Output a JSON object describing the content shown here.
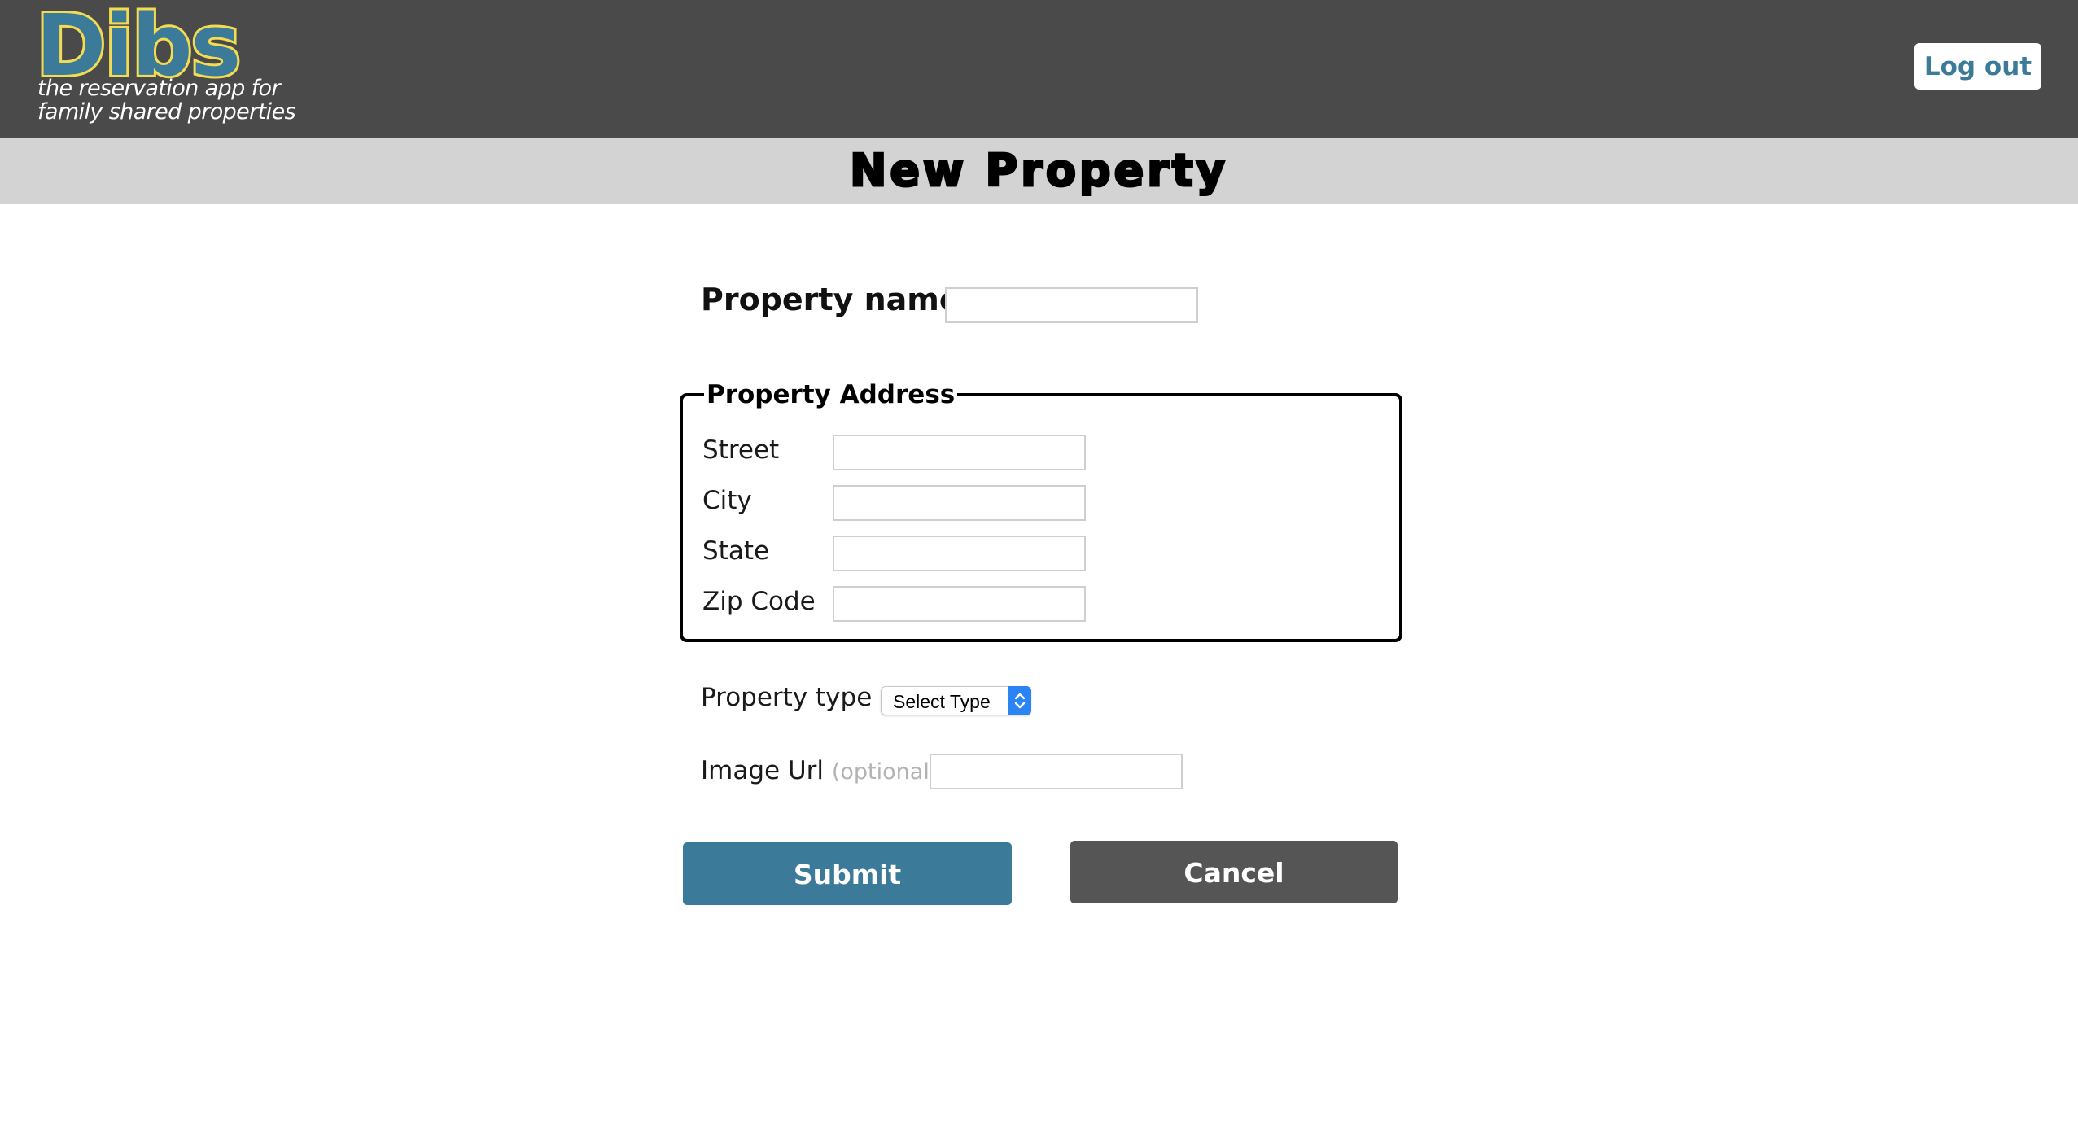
{
  "header": {
    "logo_text": "Dibs",
    "tagline_line1": "the reservation app for",
    "tagline_line2": "family shared properties",
    "logout_label": "Log out"
  },
  "page": {
    "title": "New Property"
  },
  "form": {
    "property_name": {
      "label": "Property name",
      "value": ""
    },
    "address": {
      "legend": "Property Address",
      "street_label": "Street",
      "street_value": "",
      "city_label": "City",
      "city_value": "",
      "state_label": "State",
      "state_value": "",
      "zip_label": "Zip Code",
      "zip_value": ""
    },
    "property_type": {
      "label": "Property type",
      "selected": "Select Type"
    },
    "image_url": {
      "label": "Image Url",
      "hint": "(optional)",
      "value": ""
    },
    "submit_label": "Submit",
    "cancel_label": "Cancel"
  },
  "colors": {
    "header_bg": "#4a4a4a",
    "title_band_bg": "#d3d3d3",
    "brand_teal": "#3b7a98",
    "logo_outline_yellow": "#f4dc52",
    "cancel_gray": "#555555",
    "select_arrow_blue": "#2b84f3"
  }
}
